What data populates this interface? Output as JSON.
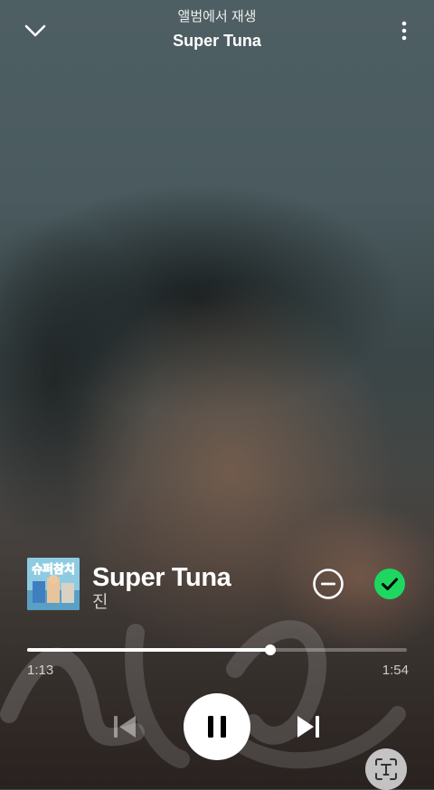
{
  "header": {
    "context_label": "앨범에서 재생",
    "context_title": "Super Tuna"
  },
  "icons": {
    "collapse": "chevron-down-icon",
    "more": "more-vertical-icon",
    "remove": "minus-circle-icon",
    "saved": "check-circle-icon",
    "previous": "skip-previous-icon",
    "pause": "pause-icon",
    "next": "skip-next-icon",
    "lens": "text-scan-icon"
  },
  "track": {
    "title": "Super Tuna",
    "artist": "진",
    "cover_text": "슈퍼참치"
  },
  "playback": {
    "elapsed": "1:13",
    "total": "1:54",
    "progress_fraction": 0.64,
    "is_playing": true
  },
  "colors": {
    "accent": "#1ed760",
    "primary_text": "#ffffff"
  }
}
